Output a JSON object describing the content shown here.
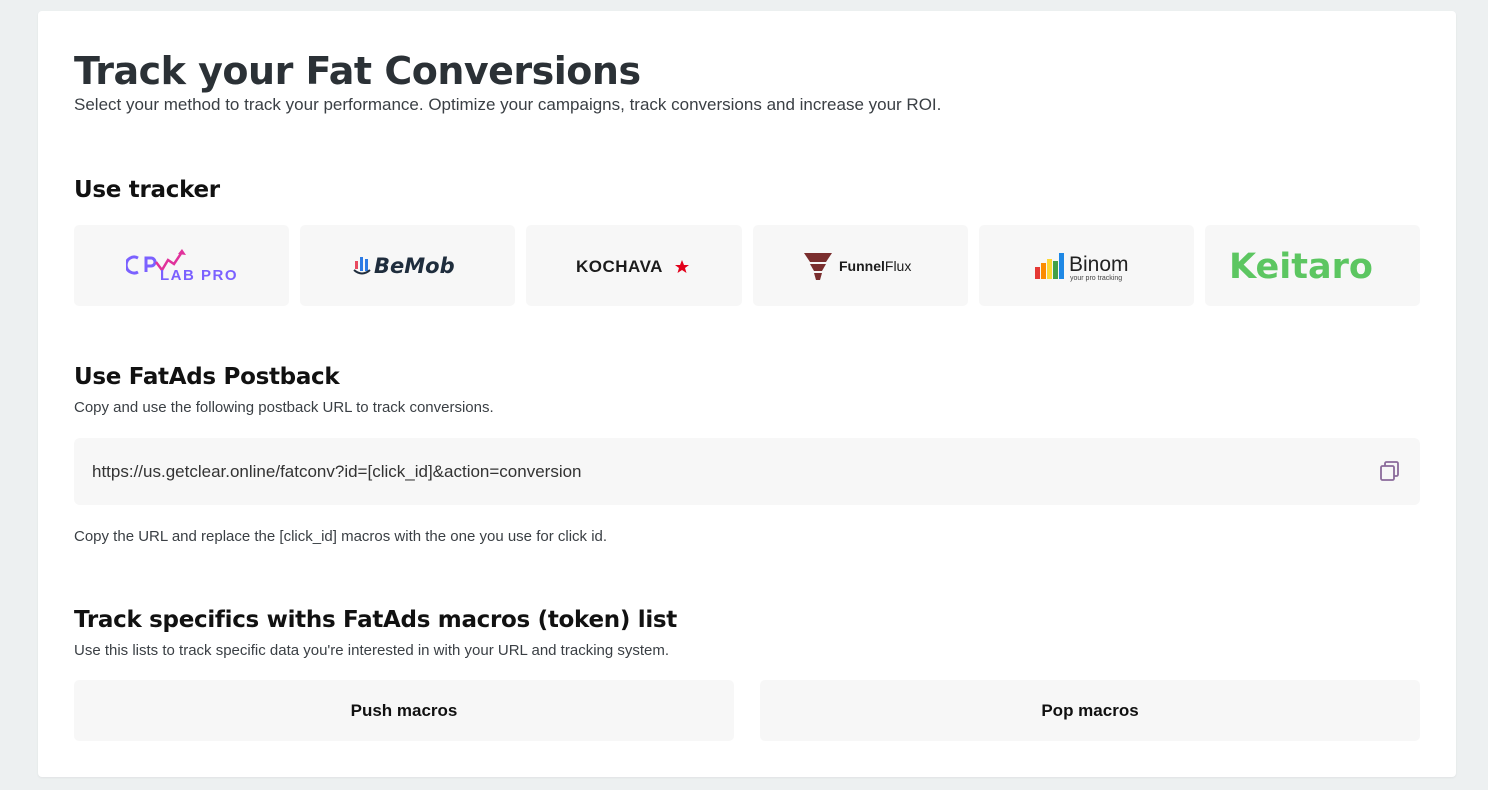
{
  "header": {
    "title": "Track your Fat Conversions",
    "subtitle": "Select your method to track your performance. Optimize your campaigns, track conversions and increase your ROI."
  },
  "trackers_section": {
    "title": "Use tracker",
    "trackers": [
      {
        "name": "CPV LAB PRO",
        "logo_text": "LAB PRO",
        "logo_mark": "CPV",
        "color": "#6c5ce7"
      },
      {
        "name": "BeMob",
        "logo_text": "BeMob",
        "color": "#1f2d3d"
      },
      {
        "name": "KOCHAVA",
        "logo_text": "KOCHAVA",
        "color": "#1c1c1c",
        "accent": "#e2001a"
      },
      {
        "name": "FunnelFlux",
        "logo_text_bold": "Funnel",
        "logo_text_light": "Flux",
        "color": "#7a2e2e"
      },
      {
        "name": "Binom",
        "logo_text": "Binom",
        "logo_tagline": "your pro tracking",
        "color": "#222222"
      },
      {
        "name": "Keitaro",
        "logo_text": "Keitaro",
        "color": "#5cc661"
      }
    ]
  },
  "postback_section": {
    "title": "Use FatAds Postback",
    "description": "Copy and use the following postback URL to track conversions.",
    "url": "https://us.getclear.online/fatconv?id=[click_id]&action=conversion",
    "note": "Copy the URL and replace the [click_id] macros with the one you use for click id."
  },
  "macros_section": {
    "title": "Track specifics withs FatAds macros (token) list",
    "description": "Use this lists to track specific data you're interested in with your URL and tracking system.",
    "push_label": "Push macros",
    "pop_label": "Pop macros"
  },
  "colors": {
    "background": "#edf0f1",
    "card": "#ffffff",
    "tile": "#f7f7f7",
    "copy_icon": "#8a6a9a"
  }
}
